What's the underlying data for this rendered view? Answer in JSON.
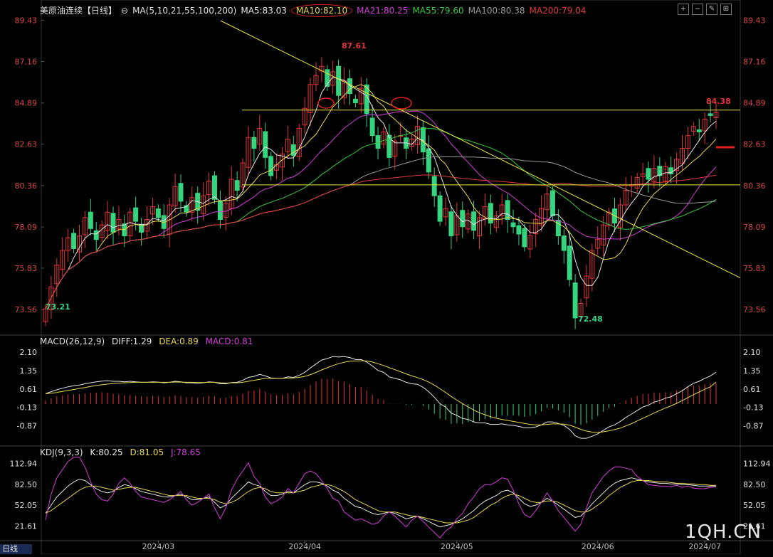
{
  "header": {
    "instrument": "美原油连续",
    "period": "【日线】",
    "ma_params": "MA(5,10,21,55,100,200)",
    "ma_values": [
      {
        "label": "MA5:83.03",
        "color": "#e6e6e6"
      },
      {
        "label": "MA10:82.10",
        "color": "#e8d84a"
      },
      {
        "label": "MA21:80.25",
        "color": "#d23ed9"
      },
      {
        "label": "MA55:79.60",
        "color": "#39c83d"
      },
      {
        "label": "MA100:80.38",
        "color": "#9a9a9a"
      },
      {
        "label": "MA200:79.04",
        "color": "#e23a3a"
      }
    ]
  },
  "macd_header": {
    "params": "MACD(26,12,9)",
    "diff": "DIFF:1.29",
    "dea": "DEA:0.89",
    "macd": "MACD:0.81"
  },
  "kdj_header": {
    "params": "KDJ(9,3,3)",
    "k": "K:80.25",
    "d": "D:81.05",
    "j": "J:78.65"
  },
  "watermark": "1QH.CN",
  "period_button": "日线",
  "colors": {
    "up": "#e2353a",
    "down": "#35d47e",
    "ma5": "#e6e6e6",
    "ma10": "#e8d84a",
    "ma21": "#d23ed9",
    "ma55": "#39c83d",
    "ma100": "#9a9a9a",
    "ma200": "#e23a3a",
    "trend": "#e8e83a",
    "highlight": "#e02020",
    "axis_text": "#e0e0e0",
    "price_axis_text": "#d84646"
  },
  "chart_data": [
    {
      "type": "candlestick",
      "title": "美原油连续【日线】",
      "y_ticks": [
        89.43,
        87.16,
        84.89,
        82.63,
        80.36,
        78.09,
        75.83,
        73.56
      ],
      "ylim": [
        72.2,
        89.6
      ],
      "x_ticks": [
        "2024/03",
        "2024/04",
        "2024/05",
        "2024/06",
        "2024/07"
      ],
      "annotations": {
        "high": "87.61",
        "low1": "73.21",
        "low2": "72.48",
        "recent": "84.38"
      },
      "horizontal_levels": [
        84.5,
        80.4
      ],
      "trendline": [
        [
          0.0,
          89.2
        ],
        [
          1.0,
          75.3
        ]
      ],
      "closes": [
        73.6,
        74.8,
        76.0,
        76.8,
        77.5,
        76.9,
        77.6,
        78.6,
        78.0,
        77.4,
        78.2,
        78.9,
        77.8,
        78.5,
        77.6,
        78.9,
        78.4,
        77.8,
        78.5,
        79.2,
        78.6,
        78.0,
        79.3,
        80.3,
        79.5,
        78.9,
        79.7,
        79.0,
        79.8,
        80.6,
        79.6,
        78.5,
        79.4,
        80.7,
        80.1,
        81.6,
        83.0,
        82.4,
        83.5,
        81.9,
        80.9,
        81.5,
        82.1,
        82.9,
        82.0,
        83.5,
        84.6,
        85.9,
        86.4,
        86.9,
        85.8,
        86.6,
        85.3,
        86.1,
        85.4,
        84.9,
        85.7,
        84.3,
        83.1,
        82.4,
        83.3,
        81.9,
        82.8,
        83.1,
        82.4,
        82.9,
        83.6,
        82.2,
        81.1,
        79.8,
        78.4,
        79.1,
        77.6,
        78.7,
        78.1,
        78.8,
        77.9,
        78.6,
        79.2,
        78.3,
        78.7,
        79.3,
        78.5,
        78.1,
        77.7,
        77.0,
        77.6,
        78.5,
        79.1,
        79.9,
        78.7,
        77.6,
        76.8,
        75.2,
        73.1,
        73.9,
        75.4,
        76.8,
        77.4,
        78.2,
        78.9,
        78.3,
        79.3,
        80.1,
        80.4,
        80.8,
        81.0,
        80.7,
        81.3,
        80.9,
        81.4,
        81.0,
        81.8,
        82.4,
        83.1,
        83.6,
        83.3,
        84.0,
        84.2,
        84.38
      ],
      "ma_series_overlay": [
        "MA5",
        "MA10",
        "MA21",
        "MA55",
        "MA100",
        "MA200"
      ]
    },
    {
      "type": "bar",
      "title": "MACD(26,12,9)",
      "y_ticks": [
        2.1,
        1.35,
        0.61,
        -0.13,
        -0.87
      ],
      "ylim": [
        -1.55,
        2.3
      ],
      "series": [
        {
          "name": "DIFF",
          "values": [
            0.42,
            0.5,
            0.58,
            0.64,
            0.7,
            0.74,
            0.77,
            0.82,
            0.86,
            0.9,
            0.93,
            0.94,
            0.92,
            0.92,
            0.9,
            0.92,
            0.9,
            0.88,
            0.88,
            0.9,
            0.89,
            0.86,
            0.88,
            0.92,
            0.9,
            0.86,
            0.86,
            0.84,
            0.86,
            0.9,
            0.88,
            0.82,
            0.82,
            0.87,
            0.88,
            0.96,
            1.08,
            1.12,
            1.2,
            1.14,
            1.06,
            1.04,
            1.04,
            1.1,
            1.08,
            1.16,
            1.28,
            1.46,
            1.62,
            1.78,
            1.84,
            1.92,
            1.9,
            1.92,
            1.88,
            1.8,
            1.8,
            1.7,
            1.54,
            1.36,
            1.28,
            1.1,
            1.04,
            0.98,
            0.88,
            0.82,
            0.8,
            0.68,
            0.5,
            0.28,
            0.02,
            -0.12,
            -0.36,
            -0.46,
            -0.58,
            -0.62,
            -0.72,
            -0.76,
            -0.76,
            -0.82,
            -0.82,
            -0.8,
            -0.84,
            -0.86,
            -0.9,
            -0.96,
            -0.96,
            -0.92,
            -0.84,
            -0.72,
            -0.72,
            -0.78,
            -0.86,
            -1.02,
            -1.28,
            -1.38,
            -1.38,
            -1.3,
            -1.2,
            -1.06,
            -0.92,
            -0.84,
            -0.7,
            -0.54,
            -0.4,
            -0.26,
            -0.12,
            -0.04,
            0.08,
            0.14,
            0.24,
            0.3,
            0.42,
            0.54,
            0.7,
            0.84,
            0.92,
            1.04,
            1.14,
            1.29
          ]
        },
        {
          "name": "DEA",
          "values": [
            0.42,
            0.44,
            0.47,
            0.51,
            0.55,
            0.59,
            0.63,
            0.67,
            0.71,
            0.75,
            0.78,
            0.81,
            0.83,
            0.85,
            0.86,
            0.87,
            0.88,
            0.88,
            0.88,
            0.88,
            0.88,
            0.88,
            0.88,
            0.89,
            0.89,
            0.88,
            0.88,
            0.87,
            0.87,
            0.88,
            0.88,
            0.86,
            0.85,
            0.86,
            0.86,
            0.88,
            0.92,
            0.96,
            1.0,
            1.04,
            1.04,
            1.04,
            1.04,
            1.05,
            1.06,
            1.08,
            1.12,
            1.19,
            1.28,
            1.38,
            1.47,
            1.56,
            1.63,
            1.69,
            1.73,
            1.74,
            1.75,
            1.74,
            1.7,
            1.63,
            1.56,
            1.47,
            1.39,
            1.31,
            1.22,
            1.14,
            1.07,
            0.99,
            0.89,
            0.77,
            0.62,
            0.47,
            0.31,
            0.16,
            0.02,
            -0.11,
            -0.24,
            -0.35,
            -0.43,
            -0.51,
            -0.57,
            -0.62,
            -0.66,
            -0.7,
            -0.74,
            -0.78,
            -0.82,
            -0.84,
            -0.84,
            -0.82,
            -0.8,
            -0.8,
            -0.81,
            -0.85,
            -0.93,
            -1.02,
            -1.09,
            -1.13,
            -1.14,
            -1.12,
            -1.08,
            -1.03,
            -0.97,
            -0.88,
            -0.79,
            -0.68,
            -0.57,
            -0.47,
            -0.36,
            -0.26,
            -0.16,
            -0.07,
            0.03,
            0.14,
            0.26,
            0.38,
            0.49,
            0.6,
            0.7,
            0.89
          ]
        }
      ]
    },
    {
      "type": "line",
      "title": "KDJ(9,3,3)",
      "y_ticks": [
        112.94,
        82.5,
        52.05,
        21.61
      ],
      "ylim": [
        0,
        125
      ],
      "series": [
        {
          "name": "K",
          "values": [
            40,
            52,
            64,
            72,
            80,
            86,
            90,
            88,
            82,
            76,
            72,
            70,
            72,
            78,
            82,
            80,
            76,
            72,
            70,
            68,
            66,
            64,
            64,
            66,
            68,
            64,
            60,
            60,
            62,
            64,
            56,
            48,
            52,
            62,
            70,
            78,
            86,
            82,
            80,
            72,
            66,
            66,
            68,
            72,
            70,
            76,
            82,
            86,
            86,
            84,
            80,
            74,
            70,
            62,
            56,
            50,
            48,
            44,
            40,
            38,
            40,
            42,
            40,
            36,
            32,
            34,
            36,
            32,
            28,
            24,
            20,
            22,
            24,
            28,
            32,
            38,
            44,
            52,
            58,
            62,
            66,
            72,
            74,
            70,
            62,
            54,
            50,
            52,
            56,
            62,
            58,
            52,
            46,
            40,
            34,
            36,
            44,
            54,
            62,
            70,
            78,
            84,
            88,
            90,
            92,
            90,
            88,
            86,
            85,
            84,
            84,
            83,
            83,
            82,
            82,
            81,
            80,
            80,
            80,
            80
          ]
        },
        {
          "name": "D",
          "values": [
            40,
            44,
            50,
            56,
            62,
            68,
            74,
            78,
            80,
            80,
            78,
            76,
            74,
            75,
            77,
            78,
            78,
            76,
            74,
            72,
            70,
            68,
            66,
            66,
            66,
            66,
            64,
            62,
            62,
            62,
            60,
            56,
            54,
            56,
            60,
            66,
            72,
            76,
            78,
            76,
            72,
            70,
            70,
            70,
            70,
            72,
            74,
            78,
            80,
            82,
            82,
            80,
            76,
            72,
            66,
            60,
            56,
            52,
            48,
            44,
            42,
            42,
            42,
            40,
            38,
            36,
            36,
            34,
            32,
            30,
            28,
            26,
            26,
            26,
            28,
            30,
            34,
            40,
            46,
            52,
            56,
            62,
            66,
            68,
            66,
            62,
            58,
            56,
            56,
            58,
            58,
            56,
            52,
            48,
            44,
            42,
            42,
            46,
            52,
            58,
            66,
            72,
            78,
            82,
            86,
            88,
            88,
            88,
            87,
            86,
            86,
            85,
            84,
            84,
            83,
            83,
            82,
            82,
            81,
            81
          ]
        },
        {
          "name": "J",
          "values": [
            30,
            68,
            92,
            104,
            116,
            122,
            122,
            108,
            86,
            68,
            60,
            58,
            68,
            84,
            92,
            84,
            72,
            64,
            62,
            60,
            58,
            56,
            60,
            66,
            72,
            60,
            52,
            56,
            62,
            68,
            48,
            32,
            48,
            74,
            90,
            102,
            114,
            94,
            84,
            64,
            54,
            58,
            64,
            76,
            70,
            84,
            98,
            102,
            98,
            88,
            76,
            62,
            58,
            42,
            36,
            30,
            32,
            28,
            24,
            26,
            36,
            42,
            36,
            28,
            20,
            30,
            36,
            28,
            20,
            12,
            4,
            14,
            20,
            32,
            40,
            54,
            64,
            76,
            82,
            82,
            86,
            92,
            90,
            74,
            54,
            38,
            34,
            44,
            56,
            70,
            58,
            44,
            34,
            24,
            14,
            24,
            48,
            70,
            82,
            94,
            102,
            108,
            108,
            106,
            104,
            94,
            88,
            82,
            81,
            80,
            80,
            79,
            81,
            78,
            80,
            77,
            76,
            76,
            78,
            78.65
          ]
        }
      ]
    }
  ]
}
